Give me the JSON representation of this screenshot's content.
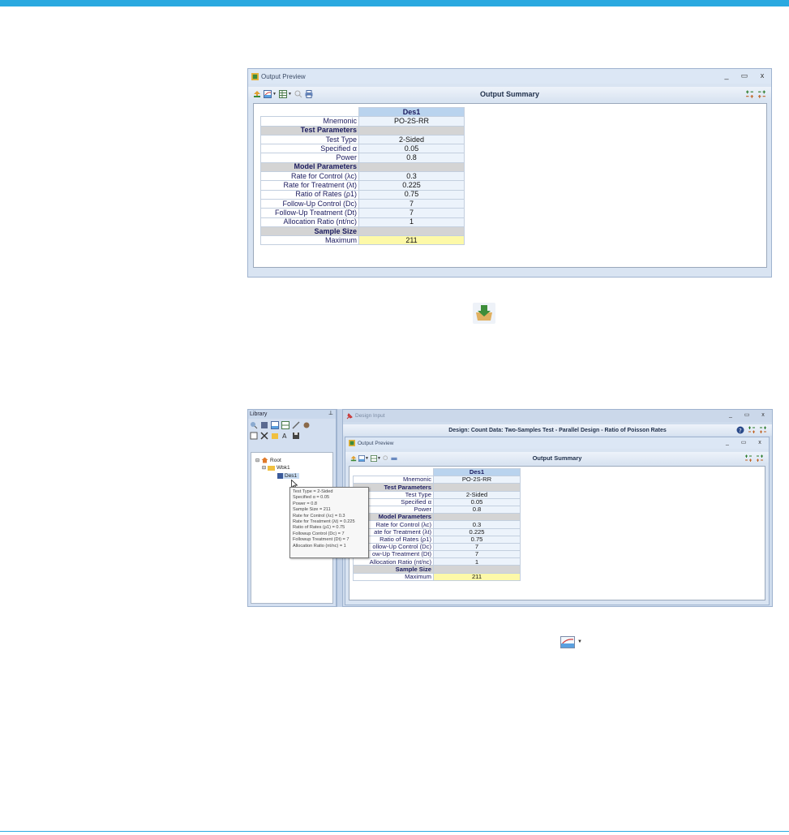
{
  "top": {
    "window_title": "Output Preview",
    "toolbar_title": "Output Summary",
    "controls": {
      "minimize": "_",
      "maximize": "▭",
      "close": "x"
    }
  },
  "table": {
    "column_header": "Des1",
    "mnemonic_label": "Mnemonic",
    "mnemonic_value": "PO-2S-RR",
    "sections": [
      {
        "title": "Test Parameters",
        "rows": [
          {
            "label": "Test Type",
            "value": "2-Sided"
          },
          {
            "label": "Specified α",
            "value": "0.05"
          },
          {
            "label": "Power",
            "value": "0.8"
          }
        ]
      },
      {
        "title": "Model Parameters",
        "rows": [
          {
            "label": "Rate for Control (λc)",
            "value": "0.3"
          },
          {
            "label": "Rate for Treatment (λt)",
            "value": "0.225"
          },
          {
            "label": "Ratio of Rates (ρ1)",
            "value": "0.75"
          },
          {
            "label": "Follow-Up Control (Dc)",
            "value": "7"
          },
          {
            "label": "Follow-Up Treatment (Dt)",
            "value": "7"
          },
          {
            "label": "Allocation Ratio (nt/nc)",
            "value": "1"
          }
        ]
      },
      {
        "title": "Sample Size",
        "rows": [
          {
            "label": "Maximum",
            "value": "211"
          }
        ]
      }
    ]
  },
  "small_table_labels": {
    "rate_control": "Rate for Control (λc)",
    "rate_treatment": "ate for Treatment (λt)",
    "ratio": "Ratio of Rates (ρ1)",
    "fu_control": "ollow-Up Control (Dc)",
    "fu_treatment": "ow-Up Treatment (Dt)",
    "alloc": "Allocation Ratio (nt/nc)"
  },
  "bottom": {
    "library_title": "Library",
    "design_input_title": "Design Input",
    "design_header": "Design: Count Data: Two-Samples Test - Parallel Design - Ratio of Poisson Rates",
    "output_preview_title": "Output Preview",
    "toolbar_title": "Output Summary",
    "tree": {
      "root": "Root",
      "workbook": "Wbk1",
      "design": "Des1"
    },
    "tooltip_lines": [
      "Test Type = 2-Sided",
      "Specified α = 0.05",
      "Power = 0.8",
      "Sample Size = 211",
      "Rate for Control (λc) = 0.3",
      "Rate for Treatment (λt) = 0.225",
      "Ratio of Rates (ρ1) = 0.75",
      "Followup Control (Dc) = 7",
      "Followup Treatment (Dt) = 7",
      "Allocation Ratio (nt/nc) = 1"
    ]
  },
  "icons": [
    "save-to-library-icon",
    "export-chart-icon",
    "find-icon",
    "print-icon",
    "table-icon",
    "help-icon"
  ],
  "colors": {
    "accent_bar": "#2aa9e0",
    "header_cell": "#b9d3ee",
    "section_row": "#d4d4d4",
    "highlight_cell": "#fdf9a8"
  }
}
